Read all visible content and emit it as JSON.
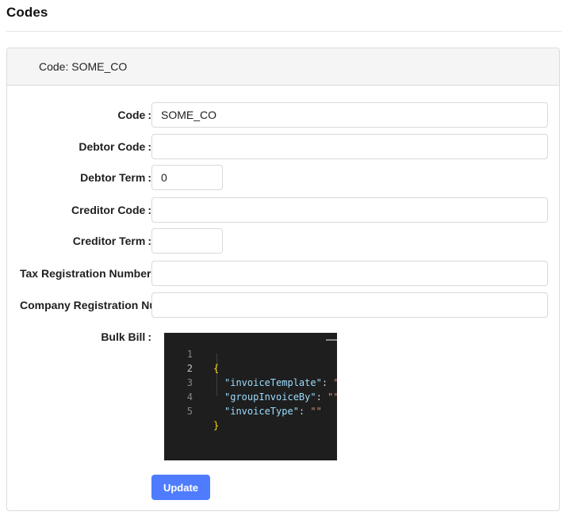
{
  "page": {
    "title": "Codes"
  },
  "card": {
    "header_label": "Code:",
    "header_value": "SOME_CO"
  },
  "form": {
    "code": {
      "label": "Code",
      "value": "SOME_CO"
    },
    "debtor_code": {
      "label": "Debtor Code",
      "value": ""
    },
    "debtor_term": {
      "label": "Debtor Term",
      "value": "0"
    },
    "creditor_code": {
      "label": "Creditor Code",
      "value": ""
    },
    "creditor_term": {
      "label": "Creditor Term",
      "value": ""
    },
    "tax_registration_number": {
      "label": "Tax Registration Number",
      "value": ""
    },
    "company_registration_number": {
      "label": "Company Registration Nu",
      "value": ""
    },
    "bulk_bill": {
      "label": "Bulk Bill"
    },
    "colon": ":"
  },
  "editor": {
    "line_numbers": [
      "1",
      "2",
      "3",
      "4",
      "5"
    ],
    "open_brace": "{",
    "close_brace": "}",
    "lines": [
      {
        "key": "\"invoiceTemplate\"",
        "sep": ": ",
        "value": "\""
      },
      {
        "key": "\"groupInvoiceBy\"",
        "sep": ": ",
        "value": "\"\""
      },
      {
        "key": "\"invoiceType\"",
        "sep": ": ",
        "value": "\"\""
      }
    ],
    "colors": {
      "background": "#1e1e1e",
      "brace": "#ffd700",
      "key": "#9cdcfe",
      "string": "#ce9178"
    }
  },
  "actions": {
    "update_label": "Update"
  },
  "colors": {
    "primary": "#4f7cff",
    "border": "#d9d9d9",
    "header_bg": "#f5f5f5"
  }
}
